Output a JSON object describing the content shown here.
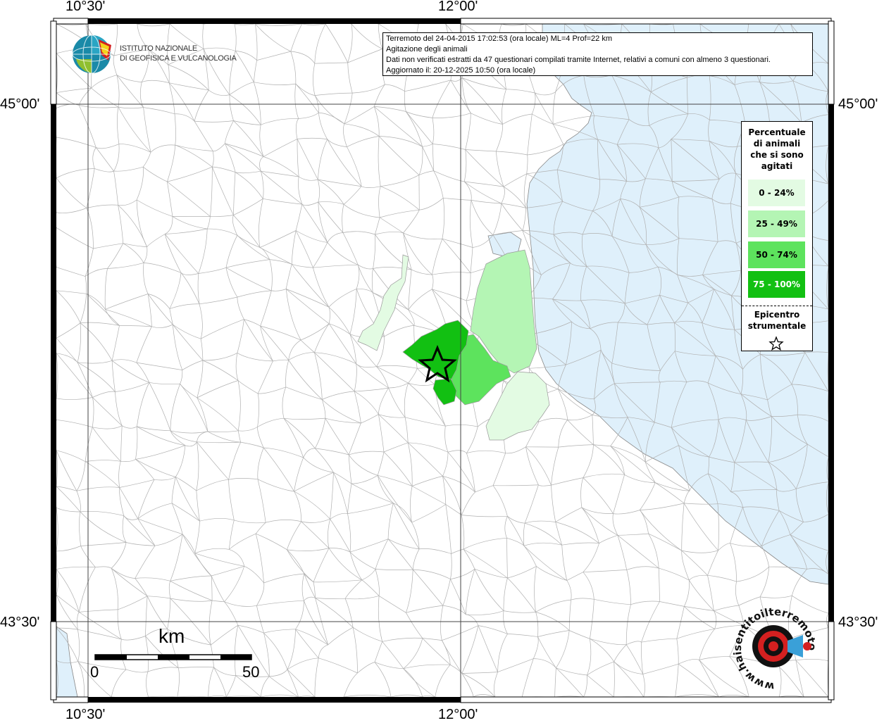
{
  "frame": {
    "lon_left_top": "10°30'",
    "lon_right_top": "12°00'",
    "lon_left_bottom": "10°30'",
    "lon_right_bottom": "12°00'",
    "lat_top_left": "45°00'",
    "lat_top_right": "45°00'",
    "lat_bottom_left": "43°30'",
    "lat_bottom_right": "43°30'"
  },
  "info": {
    "line1": "Terremoto del 24-04-2015 17:02:53 (ora locale) ML=4 Prof=22 km",
    "line2": "Agitazione degli animali",
    "line3": "Dati non verificati estratti da 47 questionari compilati tramite Internet, relativi a comuni con almeno 3 questionari.",
    "line4": "Aggiornato il: 20-12-2025 10:50 (ora locale)"
  },
  "logo": {
    "line1": "ISTITUTO NAZIONALE",
    "line2": "DI GEOFISICA E VULCANOLOGIA"
  },
  "legend": {
    "title_lines": [
      "Percentuale",
      "di animali",
      "che si sono",
      "agitati"
    ],
    "items": [
      {
        "label": "0 - 24%",
        "color": "#e3fbe3"
      },
      {
        "label": "25 - 49%",
        "color": "#b4f5b4"
      },
      {
        "label": "50 - 74%",
        "color": "#5de35d"
      },
      {
        "label": "75 - 100%",
        "color": "#12c012"
      }
    ],
    "epicenter_lines": [
      "Epicentro",
      "strumentale"
    ]
  },
  "scale": {
    "unit": "km",
    "start": "0",
    "end": "50"
  },
  "watermark": {
    "text": "www.haisentitoilterremoto.it"
  },
  "colors": {
    "sea": "#dff0fb",
    "land": "#ffffff",
    "border": "#aaaaaa"
  }
}
